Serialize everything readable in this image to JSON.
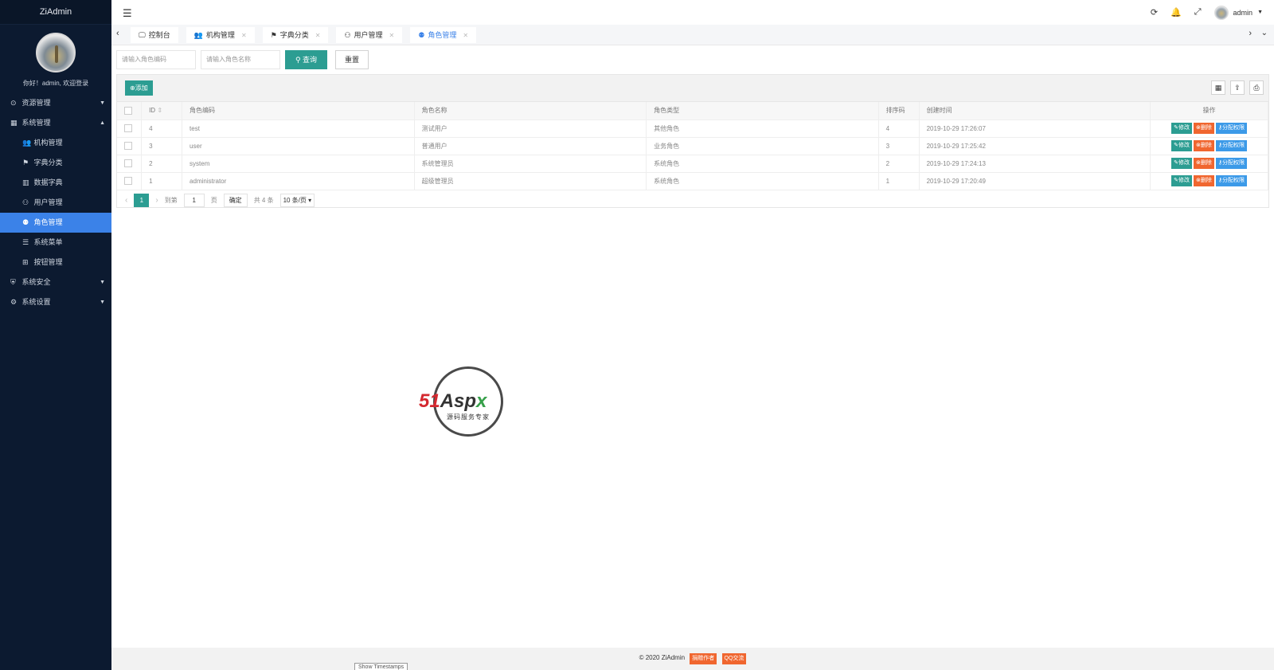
{
  "app": {
    "title": "ZiAdmin"
  },
  "sidebar": {
    "welcome": "你好！admin, 欢迎登录",
    "menu": [
      {
        "label": "资源管理",
        "icon": "database-icon",
        "expanded": false
      },
      {
        "label": "系统管理",
        "icon": "grid-icon",
        "expanded": true
      },
      {
        "label": "系统安全",
        "icon": "shield-icon",
        "expanded": false
      },
      {
        "label": "系统设置",
        "icon": "gear-icon",
        "expanded": false
      }
    ],
    "sub_items": [
      {
        "label": "机构管理",
        "icon": "users-icon"
      },
      {
        "label": "字典分类",
        "icon": "tag-icon"
      },
      {
        "label": "数据字典",
        "icon": "bar-chart-icon"
      },
      {
        "label": "用户管理",
        "icon": "user-icon"
      },
      {
        "label": "角色管理",
        "icon": "role-icon",
        "active": true
      },
      {
        "label": "系统菜单",
        "icon": "list-icon"
      },
      {
        "label": "按钮管理",
        "icon": "apps-icon"
      }
    ]
  },
  "header": {
    "user": "admin",
    "icons": [
      "refresh-icon",
      "bell-icon",
      "fullscreen-icon"
    ]
  },
  "tabs": [
    {
      "label": "控制台",
      "icon": "monitor-icon",
      "closable": false
    },
    {
      "label": "机构管理",
      "icon": "users-icon",
      "closable": true
    },
    {
      "label": "字典分类",
      "icon": "tag-icon",
      "closable": true
    },
    {
      "label": "用户管理",
      "icon": "user-icon",
      "closable": true
    },
    {
      "label": "角色管理",
      "icon": "role-icon",
      "closable": true,
      "active": true
    }
  ],
  "search": {
    "code_placeholder": "请输入角色编码",
    "name_placeholder": "请输入角色名称",
    "search_label": "查询",
    "reset_label": "重置"
  },
  "toolbar": {
    "add_label": "添加"
  },
  "table": {
    "columns": [
      "ID",
      "角色编码",
      "角色名称",
      "角色类型",
      "排序码",
      "创建时间",
      "操作"
    ],
    "rows": [
      {
        "id": "4",
        "code": "test",
        "name": "测试用户",
        "type": "其他角色",
        "sort": "4",
        "created": "2019-10-29 17:26:07"
      },
      {
        "id": "3",
        "code": "user",
        "name": "普通用户",
        "type": "业务角色",
        "sort": "3",
        "created": "2019-10-29 17:25:42"
      },
      {
        "id": "2",
        "code": "system",
        "name": "系统管理员",
        "type": "系统角色",
        "sort": "2",
        "created": "2019-10-29 17:24:13"
      },
      {
        "id": "1",
        "code": "administrator",
        "name": "超级管理员",
        "type": "系统角色",
        "sort": "1",
        "created": "2019-10-29 17:20:49"
      }
    ],
    "actions": {
      "edit": "修改",
      "delete": "删除",
      "perm": "分配权限"
    }
  },
  "pager": {
    "current": "1",
    "goto_label": "到第",
    "goto_value": "1",
    "page_unit": "页",
    "confirm": "确定",
    "total": "共 4 条",
    "page_size": "10 条/页"
  },
  "watermark": {
    "brand_51": "51",
    "brand_as": "Asp",
    "brand_x": "x",
    "subtitle": "源码服务专家"
  },
  "footer": {
    "copyright": "© 2020 ZiAdmin",
    "badge1": "捐赠作者",
    "badge2": "QQ交流",
    "timestamps_btn": "Show Timestamps"
  },
  "colors": {
    "sidebar_bg": "#0c1a30",
    "active_blue": "#3b82e8",
    "teal": "#2c9d92",
    "orange": "#f0662f"
  }
}
